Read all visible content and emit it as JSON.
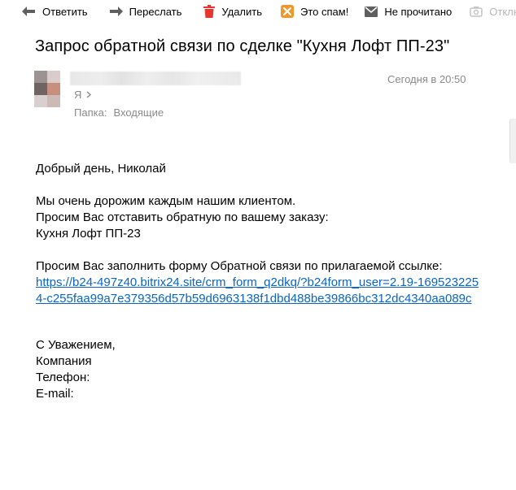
{
  "toolbar": {
    "reply_label": "Ответить",
    "forward_label": "Переслать",
    "delete_label": "Удалить",
    "spam_label": "Это спам!",
    "unread_label": "Не прочитано",
    "off_label": "Отклю"
  },
  "message": {
    "subject": "Запрос обратной связи по сделке \"Кухня Лофт ПП-23\"",
    "date": "Сегодня в 20:50",
    "recipient": "Я",
    "folder_label": "Папка:",
    "folder_value": "Входящие"
  },
  "body": {
    "greeting": "Добрый день, Николай",
    "line1": "Мы очень дорожим каждым нашим клиентом.",
    "line2": "Просим Вас отставить обратную по вашему заказу:",
    "line3": "Кухня Лофт ПП-23",
    "line4": "Просим Вас заполнить форму Обратной связи по прилагаемой ссылке:",
    "link": "https://b24-497z40.bitrix24.site/crm_form_q2dkq/?b24form_user=2.19-1695232254-c255faa99a7e379356d57b59d6963138f1dbd488be39866bc312dc4340aa089c",
    "closing": "С Уважением,",
    "company": "Компания",
    "phone": "Телефон:",
    "email": "E-mail:"
  },
  "icons": {
    "reply": "reply-arrow-icon",
    "forward": "forward-arrow-icon",
    "delete": "trash-icon",
    "spam": "spam-icon",
    "unread": "envelope-icon",
    "off": "disable-icon"
  },
  "colors": {
    "link": "#0a65c2",
    "trash": "#e8352f",
    "spam": "#f0962a",
    "muted": "#8a8a8a"
  }
}
